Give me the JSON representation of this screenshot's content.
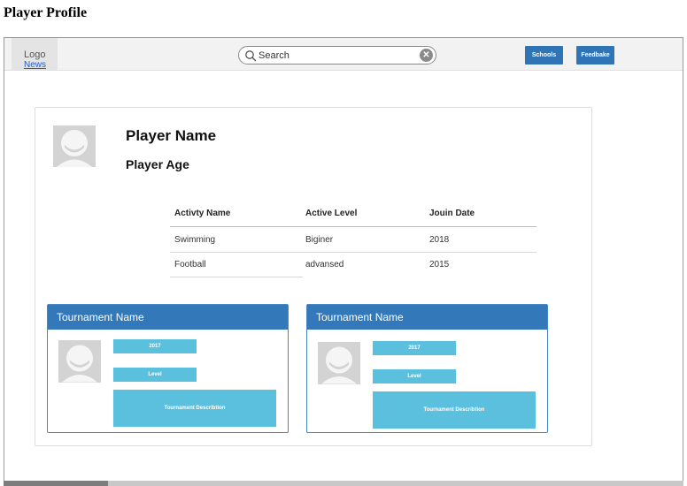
{
  "page": {
    "title": "Player Profile"
  },
  "topbar": {
    "logo": "Logo",
    "news": "News",
    "search_placeholder": "Search",
    "schools": "Schools",
    "feedback": "Feedbake"
  },
  "profile": {
    "name": "Player Name",
    "age": "Player Age"
  },
  "activities": {
    "headers": [
      "Activty Name",
      "Active Level",
      "Jouin Date"
    ],
    "rows": [
      [
        "Swimming",
        "Biginer",
        "2018"
      ],
      [
        "Football",
        "advansed",
        "2015"
      ]
    ]
  },
  "tournaments": [
    {
      "name": "Tournament Name",
      "year": "2017",
      "level": "Level",
      "description": "Tournament Describtion"
    },
    {
      "name": "Tournament Name",
      "year": "2017",
      "level": "Level",
      "description": "Tournament Describtion"
    }
  ],
  "colors": {
    "nav_button": "#2f74b5",
    "card_header": "#3378b8",
    "tag": "#5bc0de"
  }
}
